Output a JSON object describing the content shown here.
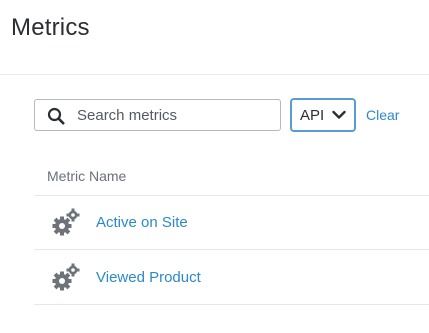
{
  "page": {
    "title": "Metrics"
  },
  "filters": {
    "search_placeholder": "Search metrics",
    "search_value": "",
    "source_selected": "API",
    "clear_label": "Clear"
  },
  "table": {
    "column_header": "Metric Name",
    "rows": [
      {
        "icon": "gears-icon",
        "name": "Active on Site"
      },
      {
        "icon": "gears-icon",
        "name": "Viewed Product"
      }
    ]
  },
  "colors": {
    "link": "#2b89c9",
    "select_border": "#5b9bd5",
    "icon_gray": "#6e737a"
  }
}
